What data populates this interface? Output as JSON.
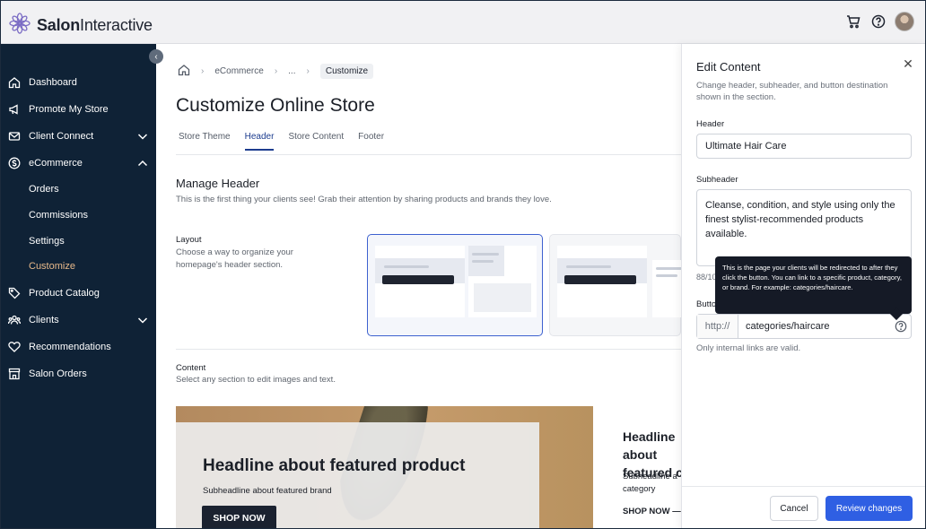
{
  "app": {
    "logo_text_bold": "Salon",
    "logo_text_rest": "Interactive"
  },
  "topbar": {
    "icons": [
      "cart-icon",
      "help-icon",
      "avatar"
    ]
  },
  "sidebar": {
    "items": [
      {
        "label": "Dashboard",
        "icon": "home-icon"
      },
      {
        "label": "Promote My Store",
        "icon": "megaphone-icon"
      },
      {
        "label": "Client Connect",
        "icon": "mail-icon",
        "chevron": "down"
      },
      {
        "label": "eCommerce",
        "icon": "dollar-icon",
        "chevron": "up"
      },
      {
        "label": "Product Catalog",
        "icon": "tag-icon"
      },
      {
        "label": "Clients",
        "icon": "users-icon",
        "chevron": "down"
      },
      {
        "label": "Recommendations",
        "icon": "heart-icon"
      },
      {
        "label": "Salon Orders",
        "icon": "store-icon"
      }
    ],
    "sub_items": [
      "Orders",
      "Commissions",
      "Settings",
      "Customize"
    ],
    "active_sub": "Customize"
  },
  "breadcrumb": {
    "items": [
      "eCommerce",
      "...",
      "Customize"
    ]
  },
  "page": {
    "title": "Customize Online Store",
    "tabs": [
      "Store Theme",
      "Header",
      "Store Content",
      "Footer"
    ],
    "active_tab": "Header",
    "manage_header": {
      "title": "Manage Header",
      "subtitle": "This is the first thing your clients see! Grab their attention by sharing products and brands they love."
    },
    "layout": {
      "label": "Layout",
      "description": "Choose a way to organize your homepage's header section."
    },
    "content": {
      "label": "Content",
      "description": "Select any section to edit images and text."
    },
    "hero": {
      "headline": "Headline about featured product",
      "subheadline": "Subheadline about featured brand",
      "button": "SHOP NOW"
    },
    "card2": {
      "headline": "Headline about featured c",
      "subheadline": "Subheadline a category",
      "link": "SHOP NOW —"
    }
  },
  "panel": {
    "title": "Edit Content",
    "subtitle": "Change header, subheader, and button destination shown in the section.",
    "header_label": "Header",
    "header_value": "Ultimate Hair Care",
    "subheader_label": "Subheader",
    "subheader_value": "Cleanse, condition, and style using only the finest stylist-recommended products available.",
    "char_count": "88/10",
    "button_label": "Butto",
    "url_prefix": "http://",
    "url_value": "categories/haircare",
    "url_hint": "Only internal links are valid.",
    "tooltip": "This is the page your clients will be redirected to after they click the button. You can link to a specific product, category, or brand. For example: categories/haircare.",
    "cancel": "Cancel",
    "review": "Review changes"
  },
  "colors": {
    "sidebar_bg": "#0f2236",
    "accent_blue": "#2f5fe3",
    "active_sub": "#e7b98a",
    "tab_active": "#1d3d8f"
  }
}
